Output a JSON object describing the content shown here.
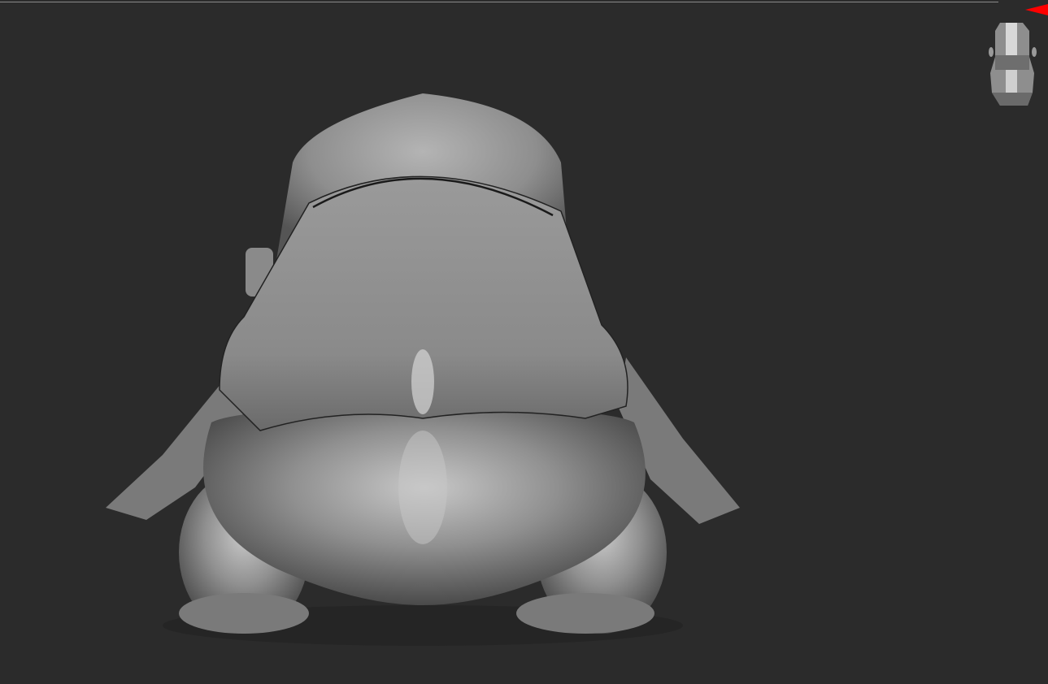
{
  "viewport": {
    "background_color": "#2b2b2b",
    "model_color": "#8c8c8c",
    "indicator_color": "#ff0000"
  },
  "icons": {
    "navigation": "head-navigation-gizmo-icon",
    "orientation": "red-orientation-marker-icon"
  }
}
